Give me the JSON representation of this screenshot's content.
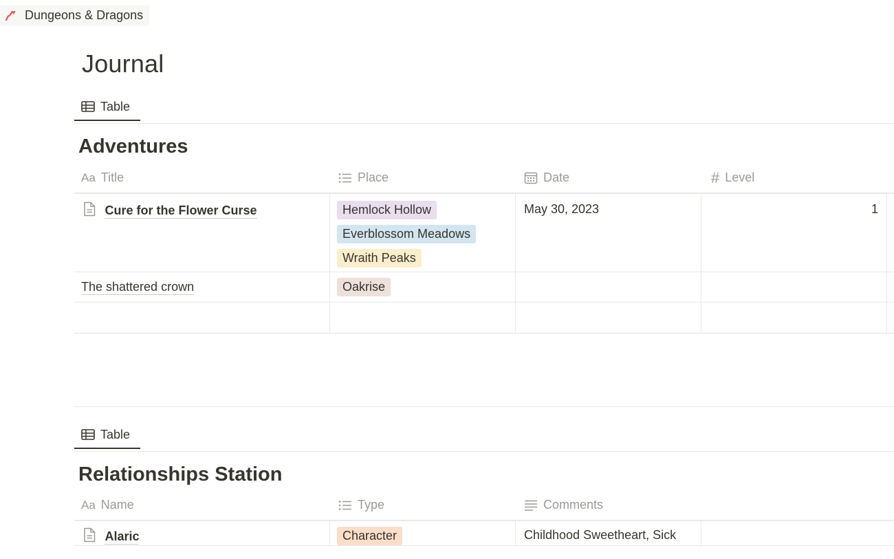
{
  "breadcrumb": {
    "workspace": "Dungeons & Dragons",
    "icon": "dragon-logo-icon"
  },
  "page": {
    "title": "Journal"
  },
  "adventures": {
    "tab_label": "Table",
    "title": "Adventures",
    "columns": [
      {
        "label": "Title",
        "icon": "Aa"
      },
      {
        "label": "Place",
        "icon": "list-icon"
      },
      {
        "label": "Date",
        "icon": "calendar-icon"
      },
      {
        "label": "Level",
        "icon": "#"
      }
    ],
    "rows": [
      {
        "title": "Cure for the Flower Curse",
        "places": [
          {
            "label": "Hemlock Hollow",
            "color": "#e8deee"
          },
          {
            "label": "Everblossom Meadows",
            "color": "#d3e5ef"
          },
          {
            "label": "Wraith Peaks",
            "color": "#fbeecc"
          }
        ],
        "date": "May 30, 2023",
        "level": "1"
      },
      {
        "title": "The shattered crown",
        "places": [
          {
            "label": "Oakrise",
            "color": "#eee0da"
          }
        ],
        "date": "",
        "level": ""
      }
    ]
  },
  "relationships": {
    "tab_label": "Table",
    "title": "Relationships Station",
    "columns": [
      {
        "label": "Name",
        "icon": "Aa"
      },
      {
        "label": "Type",
        "icon": "list-icon"
      },
      {
        "label": "Comments",
        "icon": "text-lines-icon"
      }
    ],
    "rows": [
      {
        "name": "Alaric",
        "type": {
          "label": "Character",
          "color": "#fadec9"
        },
        "comments": "Childhood Sweetheart, Sick"
      }
    ]
  }
}
